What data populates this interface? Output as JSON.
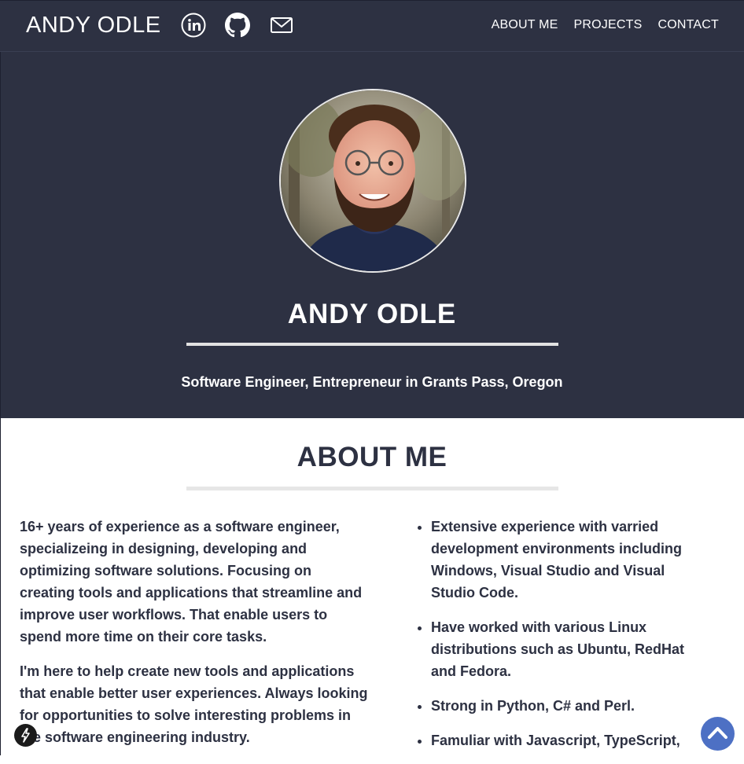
{
  "navbar": {
    "brand": "ANDY ODLE",
    "social": [
      {
        "icon": "linkedin-icon"
      },
      {
        "icon": "github-icon"
      },
      {
        "icon": "mail-icon"
      }
    ],
    "links": [
      "ABOUT ME",
      "PROJECTS",
      "CONTACT"
    ]
  },
  "hero": {
    "title": "ANDY ODLE",
    "subtitle": "Software Engineer, Entrepreneur in Grants Pass, Oregon"
  },
  "about": {
    "title": "ABOUT ME",
    "paragraphs": [
      "16+ years of experience as a software engineer, specializeing in designing, developing and optimizing software solutions. Focusing on creating tools and applications that streamline and improve user workflows. That enable users to spend more time on their core tasks.",
      "I'm here to help create new tools and applications that enable better user experiences. Always looking for opportunities to solve interesting problems in the software engineering industry."
    ],
    "bullets": [
      "Extensive experience with varried development environments including Windows, Visual Studio and Visual Studio Code.",
      "Have worked with various Linux distributions such as Ubuntu, RedHat and Fedora.",
      "Strong in Python, C# and Perl.",
      "Famuliar with Javascript, TypeScript,"
    ]
  },
  "colors": {
    "dark": "#2d3142",
    "accent": "#4d70c4"
  },
  "floating": {
    "scroll_top_icon": "chevron-up-icon",
    "bolt_icon": "bolt-icon"
  }
}
